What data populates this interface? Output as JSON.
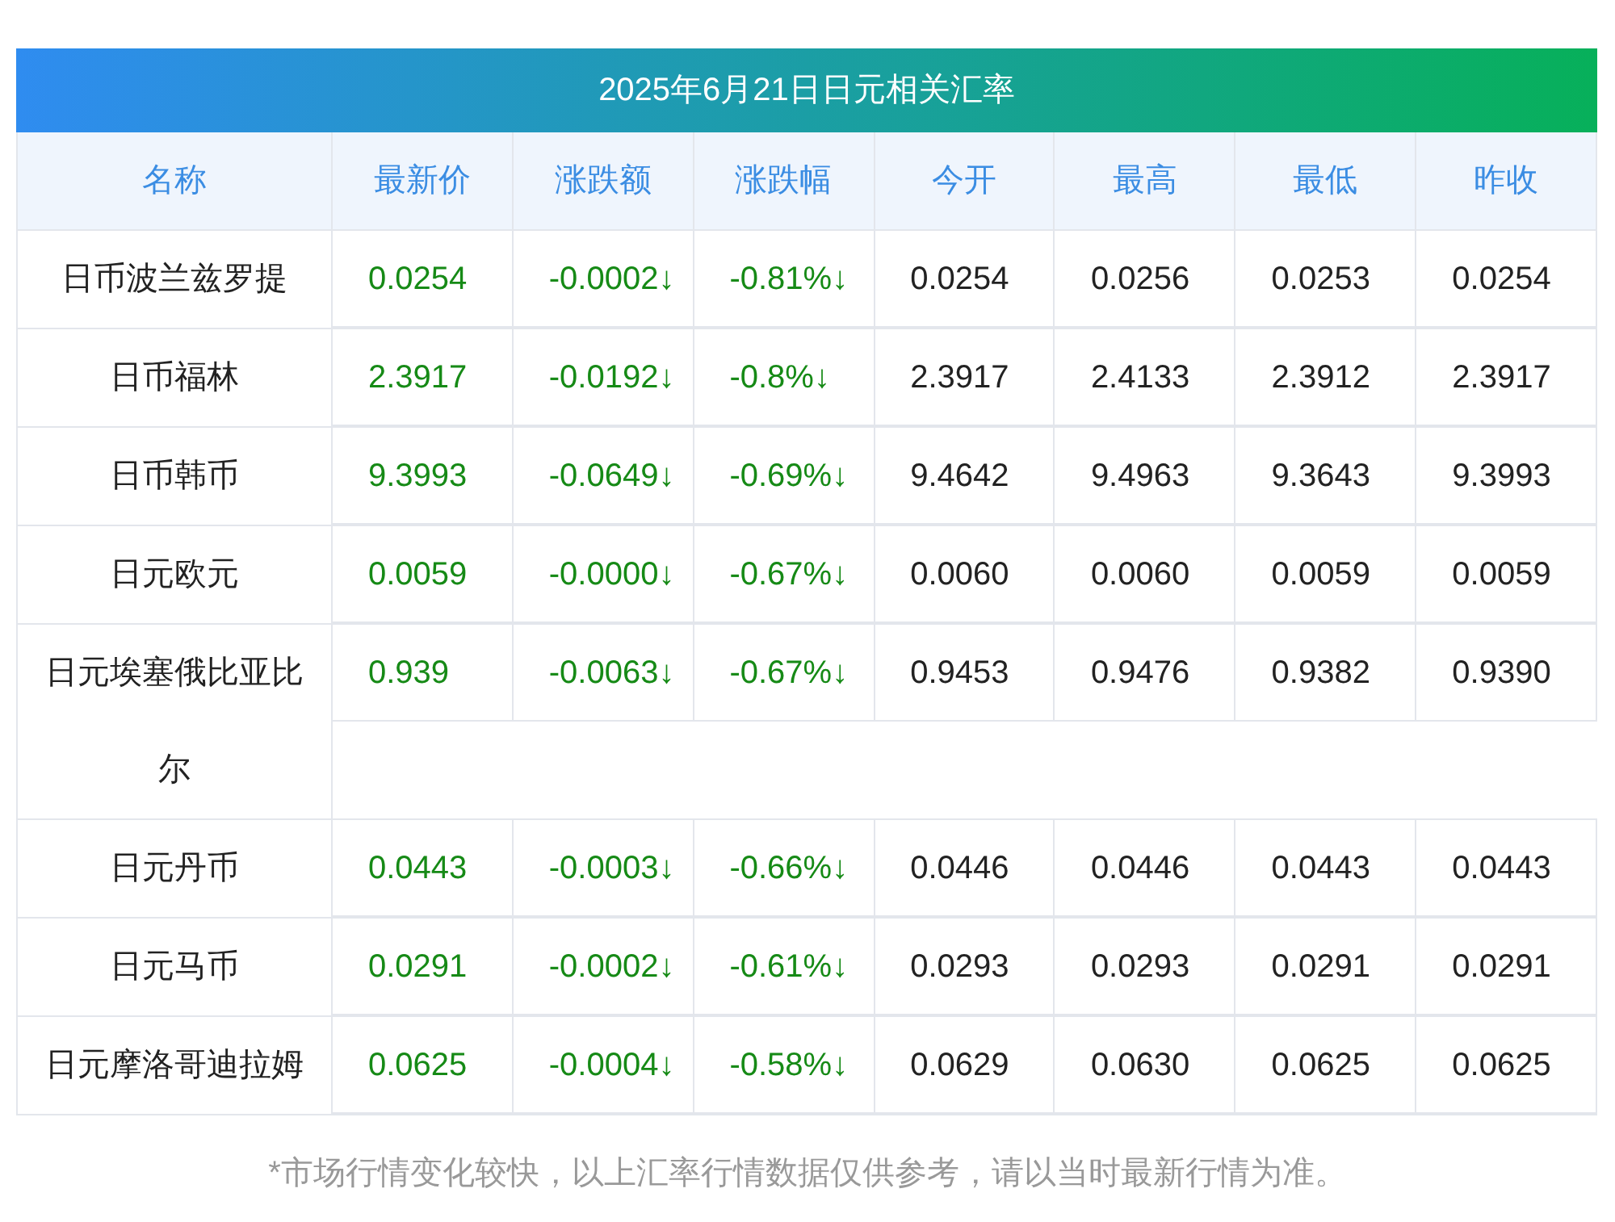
{
  "title": "2025年6月21日日元相关汇率",
  "columns": [
    "名称",
    "最新价",
    "涨跌额",
    "涨跌幅",
    "今开",
    "最高",
    "最低",
    "昨收"
  ],
  "rows": [
    {
      "color": "#168a16",
      "cells": [
        "日币波兰兹罗提",
        "0.0254",
        "-0.0002↓",
        "-0.81%↓",
        "0.0254",
        "0.0256",
        "0.0253",
        "0.0254"
      ]
    },
    {
      "color": "#168a16",
      "cells": [
        "日币福林",
        "2.3917",
        "-0.0192↓",
        "-0.8%↓",
        "2.3917",
        "2.4133",
        "2.3912",
        "2.3917"
      ]
    },
    {
      "color": "#168a16",
      "cells": [
        "日币韩币",
        "9.3993",
        "-0.0649↓",
        "-0.69%↓",
        "9.4642",
        "9.4963",
        "9.3643",
        "9.3993"
      ]
    },
    {
      "color": "#168a16",
      "cells": [
        "日元欧元",
        "0.0059",
        "-0.0000↓",
        "-0.67%↓",
        "0.0060",
        "0.0060",
        "0.0059",
        "0.0059"
      ]
    },
    {
      "color": "#168a16",
      "cells": [
        "日元埃塞俄比亚比尔",
        "0.939",
        "-0.0063↓",
        "-0.67%↓",
        "0.9453",
        "0.9476",
        "0.9382",
        "0.9390"
      ]
    },
    {
      "color": "#168a16",
      "cells": [
        "日元丹币",
        "0.0443",
        "-0.0003↓",
        "-0.66%↓",
        "0.0446",
        "0.0446",
        "0.0443",
        "0.0443"
      ]
    },
    {
      "color": "#168a16",
      "cells": [
        "日元马币",
        "0.0291",
        "-0.0002↓",
        "-0.61%↓",
        "0.0293",
        "0.0293",
        "0.0291",
        "0.0291"
      ]
    },
    {
      "color": "#168a16",
      "cells": [
        "日元摩洛哥迪拉姆",
        "0.0625",
        "-0.0004↓",
        "-0.58%↓",
        "0.0629",
        "0.0630",
        "0.0625",
        "0.0625"
      ]
    }
  ],
  "footnote": "*市场行情变化较快，以上汇率行情数据仅供参考，请以当时最新行情为准。"
}
